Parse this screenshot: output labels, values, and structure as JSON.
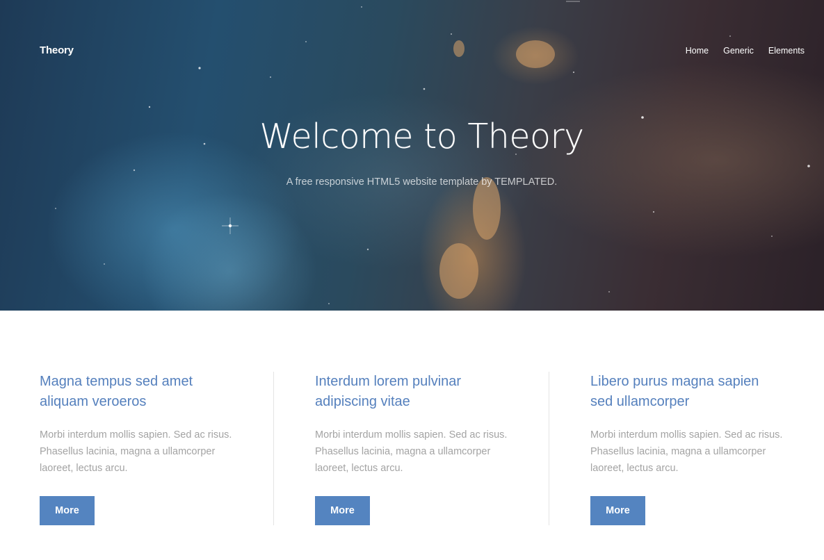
{
  "header": {
    "logo": "Theory",
    "nav": [
      "Home",
      "Generic",
      "Elements"
    ]
  },
  "banner": {
    "title": "Welcome to Theory",
    "subtitle": "A free responsive HTML5 website template by TEMPLATED."
  },
  "features": [
    {
      "title": "Magna tempus sed amet aliquam veroeros",
      "text": "Morbi interdum mollis sapien. Sed ac risus. Phasellus lacinia, magna a ullamcorper laoreet, lectus arcu.",
      "button": "More"
    },
    {
      "title": "Interdum lorem pulvinar adipiscing vitae",
      "text": "Morbi interdum mollis sapien. Sed ac risus. Phasellus lacinia, magna a ullamcorper laoreet, lectus arcu.",
      "button": "More"
    },
    {
      "title": "Libero purus magna sapien sed ullamcorper",
      "text": "Morbi interdum mollis sapien. Sed ac risus. Phasellus lacinia, magna a ullamcorper laoreet, lectus arcu.",
      "button": "More"
    }
  ],
  "colors": {
    "accent": "#5484c0",
    "heading": "#5580bd",
    "body_text": "#a3a3a3"
  }
}
